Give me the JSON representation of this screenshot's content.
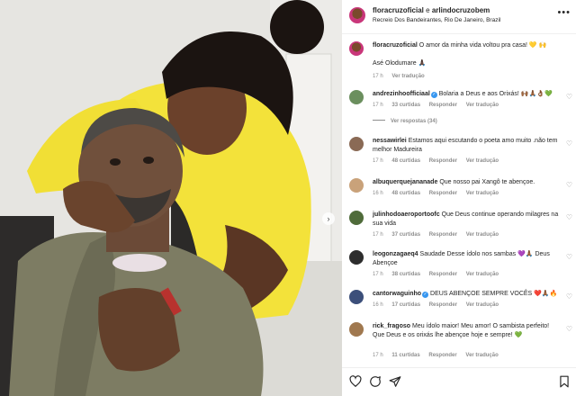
{
  "header": {
    "author": "floracruzoficial",
    "joiner": " e ",
    "coauthor": "arlindocruzobem",
    "location": "Recreio Dos Bandeirantes, Rio De Janeiro, Brazil",
    "more_icon": "more-horizontal-icon"
  },
  "caption": {
    "user": "floracruzoficial",
    "text": "O amor da minha vida voltou pra casa! 💛 🙌",
    "line2": "Asé Olodumare 🙏🏿",
    "time": "17 h",
    "translate": "Ver tradução"
  },
  "comments": [
    {
      "user": "andrezinhoofficiaal",
      "verified": true,
      "text": "Bolaria a Deus e aos Orixás! 🙌🏾🙏🏾👌🏾💚",
      "time": "17 h",
      "likes": "33 curtidas",
      "reply": "Responder",
      "translate": "Ver tradução",
      "replies": "Ver respostas (34)",
      "avatar_color": "#6b8f5e"
    },
    {
      "user": "nessawirlei",
      "verified": false,
      "text": "Estamos aqui escutando o poeta amo muito .não tem melhor Madureira",
      "time": "17 h",
      "likes": "48 curtidas",
      "reply": "Responder",
      "translate": "Ver tradução",
      "avatar_color": "#8a6a55"
    },
    {
      "user": "albuquerquejananade",
      "verified": false,
      "text": "Que nosso pai Xangô te abençoe.",
      "time": "16 h",
      "likes": "48 curtidas",
      "reply": "Responder",
      "translate": "Ver tradução",
      "avatar_color": "#c9a27a"
    },
    {
      "user": "julinhodoaeroportoofc",
      "verified": false,
      "text": "Que Deus continue operando milagres na sua vida",
      "time": "17 h",
      "likes": "37 curtidas",
      "reply": "Responder",
      "translate": "Ver tradução",
      "avatar_color": "#4f6b3a"
    },
    {
      "user": "leogonzagaeq4",
      "verified": false,
      "text": "Saudade Desse ídolo nos sambas 💜🙏🏾 Deus Abençoe",
      "time": "17 h",
      "likes": "38 curtidas",
      "reply": "Responder",
      "translate": "Ver tradução",
      "avatar_color": "#2d2d2d"
    },
    {
      "user": "cantorwaguinho",
      "verified": true,
      "text": "DEUS ABENÇOE SEMPRE VOCÊS ❤️🙏🏾🔥",
      "time": "16 h",
      "likes": "17 curtidas",
      "reply": "Responder",
      "translate": "Ver tradução",
      "avatar_color": "#3c4f7a"
    },
    {
      "user": "rick_fragoso",
      "verified": false,
      "text": "Meu ídolo maior! Meu amor! O sambista perfeito! Que Deus e os orixás lhe abençoe hoje e sempre! 💚",
      "time": "17 h",
      "likes": "11 curtidas",
      "reply": "Responder",
      "translate": "Ver tradução",
      "avatar_color": "#a0784f"
    }
  ],
  "actions": {
    "like_icon": "heart-icon",
    "comment_icon": "comment-icon",
    "share_icon": "share-icon",
    "save_icon": "bookmark-icon"
  },
  "photo": {
    "description_icon": "post-photo",
    "next_icon": "chevron-right-icon",
    "next_label": "›"
  },
  "colors": {
    "shirt_yellow": "#f3e23a",
    "verified_blue": "#3897f0",
    "meta_gray": "#8e8e8e"
  }
}
